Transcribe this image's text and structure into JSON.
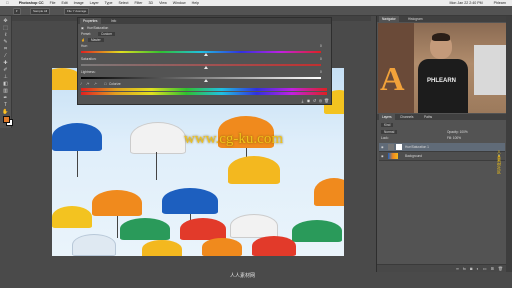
{
  "menubar": {
    "app_name": "Photoshop CC",
    "items": [
      "File",
      "Edit",
      "Image",
      "Layer",
      "Type",
      "Select",
      "Filter",
      "3D",
      "View",
      "Window",
      "Help"
    ],
    "clock": "Mon Jan 22  2:40 PM",
    "user": "Phlearn"
  },
  "options_bar": {
    "chip1": "Sample All",
    "chip2": "File Y Average"
  },
  "properties_panel": {
    "tabs": [
      "Properties",
      "Info"
    ],
    "title": "Hue/Saturation",
    "preset_label": "Preset:",
    "preset_value": "Custom",
    "channel_value": "Master",
    "labels": [
      "Hue:",
      "Saturation:",
      "Lightness:"
    ],
    "values": [
      "0",
      "0",
      "0"
    ],
    "colorize_label": "Colorize",
    "footer_icons": [
      "clip-icon",
      "eye-icon",
      "reset-icon",
      "visibility-icon",
      "trash-icon"
    ]
  },
  "canvas": {
    "watermark": "www.cg-ku.com"
  },
  "right_panel": {
    "nav_tabs": [
      "Navigator",
      "Histogram"
    ],
    "video_text": "PHLEARN",
    "video_letter": "A",
    "layers_tabs": [
      "Layers",
      "Channels",
      "Paths"
    ],
    "filter_label": "Kind",
    "blend_mode": "Normal",
    "opacity": "Opacity: 100%",
    "fill": "Fill: 100%",
    "lock_label": "Lock:",
    "layers": [
      {
        "name": "Hue/Saturation 1",
        "selected": true
      },
      {
        "name": "Background",
        "selected": false
      }
    ],
    "footer_icons": [
      "link-icon",
      "fx-icon",
      "mask-icon",
      "adjustment-icon",
      "folder-icon",
      "new-layer-icon",
      "trash-icon"
    ]
  },
  "colors": {
    "foreground": "#e07a2a",
    "background": "#ffffff",
    "watermark": "#f0c21a"
  },
  "bottom_logo": "人人素材网",
  "side_watermark": "人人素材社区"
}
